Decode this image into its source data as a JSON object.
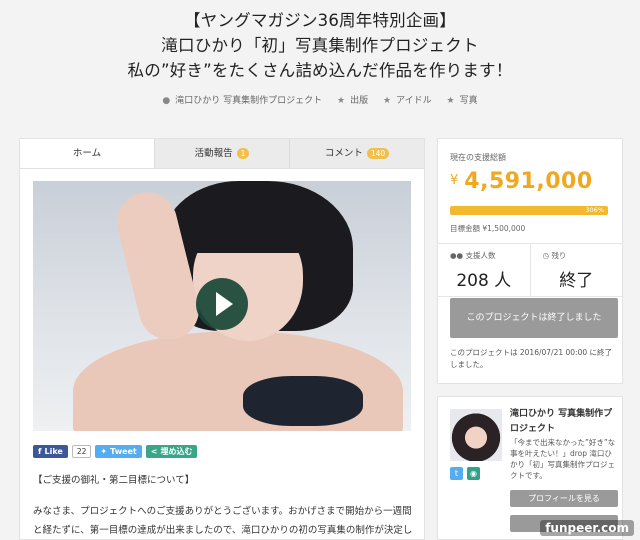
{
  "header": {
    "line1": "【ヤングマガジン36周年特別企画】",
    "line2": "滝口ひかり「初」写真集制作プロジェクト",
    "line3": "私の”好き”をたくさん詰め込んだ作品を作ります！"
  },
  "meta": {
    "owner": "滝口ひかり 写真集制作プロジェクト",
    "tag1": "出版",
    "tag2": "アイドル",
    "tag3": "写真"
  },
  "tabs": [
    {
      "label": "ホーム",
      "badge": ""
    },
    {
      "label": "活動報告",
      "badge": "1"
    },
    {
      "label": "コメント",
      "badge": "140"
    }
  ],
  "share": {
    "like_label": "Like",
    "like_count": "22",
    "tweet_label": "Tweet",
    "embed_label": "埋め込む"
  },
  "content": {
    "section_title": "【ご支援の御礼・第二目標について】",
    "paragraph": "みなさま、プロジェクトへのご支援ありがとうございます。おかげさまで開始から一週間と経たずに、第一目標の達成が出来ましたので、滝口ひかりの初の写真集の制作が決定しました。"
  },
  "funding": {
    "total_label": "現在の支援総額",
    "currency": "¥",
    "amount": "4,591,000",
    "progress_percent": 306,
    "percent_label": "306%",
    "goal_label": "目標金額 ¥1,500,000",
    "supporters_label": "支援人数",
    "supporters_value": "208 人",
    "remaining_label": "残り",
    "remaining_value": "終了",
    "ended_button": "このプロジェクトは終了しました",
    "ended_note": "このプロジェクトは 2016/07/21 00:00 に終了しました。"
  },
  "profile": {
    "name": "滝口ひかり 写真集制作プロジェクト",
    "description": "「今まで出来なかった”好き”な事を叶えたい！」drop 滝口ひかり「初」写真集制作プロジェクトです。",
    "profile_button": "プロフィールを見る"
  },
  "watermark": "funpeer.com"
}
